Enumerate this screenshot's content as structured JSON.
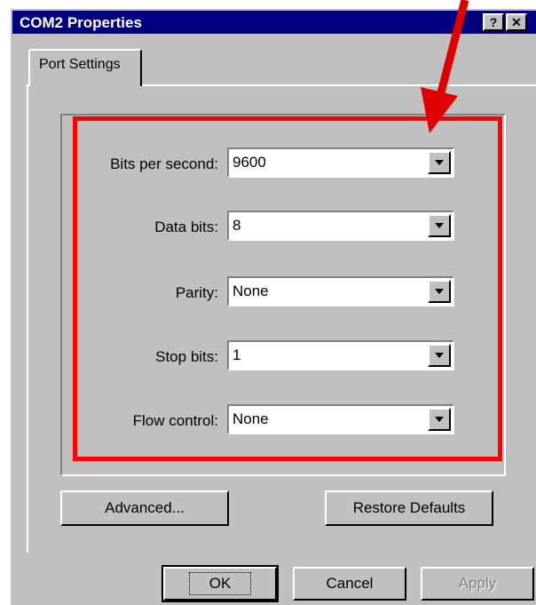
{
  "window": {
    "title": "COM2 Properties",
    "help_button": "?",
    "close_button": "✕"
  },
  "tabs": [
    {
      "label": "Port Settings",
      "selected": true
    }
  ],
  "settings": {
    "bits_per_second": {
      "label": "Bits per second:",
      "value": "9600"
    },
    "data_bits": {
      "label": "Data bits:",
      "value": "8"
    },
    "parity": {
      "label": "Parity:",
      "value": "None"
    },
    "stop_bits": {
      "label": "Stop bits:",
      "value": "1"
    },
    "flow_control": {
      "label": "Flow control:",
      "value": "None"
    }
  },
  "buttons": {
    "advanced": "Advanced...",
    "restore_defaults": "Restore Defaults",
    "ok": "OK",
    "cancel": "Cancel",
    "apply": "Apply"
  },
  "colors": {
    "title_bar": "#000080",
    "annotation": "#ff0000",
    "face": "#c0c0c0"
  }
}
